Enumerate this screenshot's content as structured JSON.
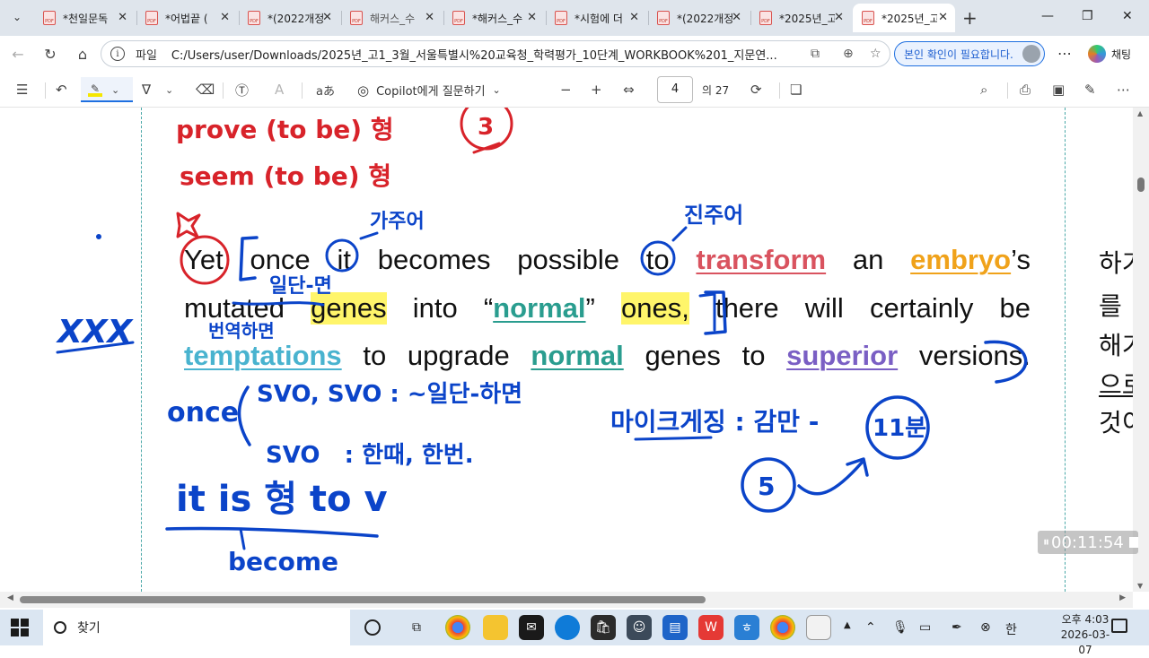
{
  "tabs": [
    {
      "title": "*천일문독",
      "active": false
    },
    {
      "title": "*어법끝 (",
      "active": false
    },
    {
      "title": "*(2022개정",
      "active": false
    },
    {
      "title": "해커스_수",
      "active": false
    },
    {
      "title": "*해커스_수",
      "active": false
    },
    {
      "title": "*시험에 더",
      "active": false
    },
    {
      "title": "*(2022개정",
      "active": false
    },
    {
      "title": "*2025년_고",
      "active": false
    },
    {
      "title": "*2025년_고",
      "active": true
    }
  ],
  "address": {
    "file_label": "파일",
    "url": "C:/Users/user/Downloads/2025년_고1_3월_서울특별시%20교육청_학력평가_10단계_WORKBOOK%201_지문연...",
    "verify_label": "본인 확인이 필요합니다.",
    "chat_label": "채팅"
  },
  "pdf_toolbar": {
    "copilot_ask": "Copilot에게 질문하기",
    "page_current": "4",
    "page_total": "의 27"
  },
  "document": {
    "line1": [
      "Yet",
      "once",
      "it",
      "becomes",
      "possible",
      "to",
      "transform",
      "an",
      "embryo",
      "’s"
    ],
    "line2": [
      "mutated",
      "genes",
      "into",
      "“normal”",
      "ones,",
      "there",
      "will",
      "certainly",
      "be"
    ],
    "line3": [
      "temptations",
      "to",
      "upgrade",
      "normal",
      "genes",
      "to",
      "superior",
      "versions."
    ],
    "side_korean": [
      "하기",
      "를",
      "해기",
      "으로",
      "것이"
    ],
    "timer": "00:11:54"
  },
  "handwriting": {
    "top1": "prove (to be) 형",
    "top2": "seem (to be) 형",
    "circle_top": "3",
    "gajuo": "가주어",
    "jinju": "진주어",
    "ildan": "일단-면",
    "beonyeok": "번역하면",
    "xxx": "XXX",
    "once_a": "once",
    "svo1": "SVO, SVO : ~일단-하면",
    "svo2": "SVO   : 한때, 한번.",
    "itis": "it is 형 to v",
    "become": "become",
    "micro": "마이크게징 : 감만 -",
    "minutes": "11분",
    "circle_5": "5"
  },
  "taskbar": {
    "search": "찾기",
    "clock_time": "오후 4:03",
    "clock_date": "2026-03-07",
    "ime": "한"
  }
}
